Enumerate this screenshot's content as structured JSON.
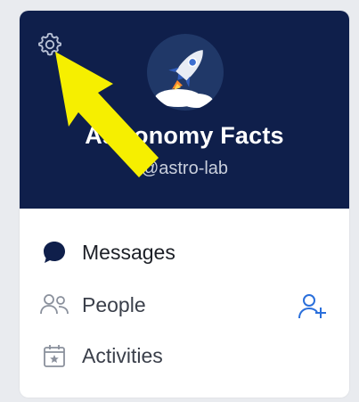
{
  "group": {
    "name": "Astronomy Facts",
    "handle": "@astro-lab"
  },
  "nav": {
    "items": [
      {
        "label": "Messages",
        "icon": "chat-bubble-icon",
        "active": true
      },
      {
        "label": "People",
        "icon": "people-icon",
        "active": false
      },
      {
        "label": "Activities",
        "icon": "calendar-star-icon",
        "active": false
      }
    ]
  },
  "header": {
    "settings_icon": "gear-icon",
    "logo_icon": "rocket-icon"
  },
  "actions": {
    "add_person_icon": "add-person-icon"
  },
  "colors": {
    "header_bg": "#0f1f4b",
    "accent": "#2a6fdb",
    "annotation_arrow": "#f6ef00"
  }
}
